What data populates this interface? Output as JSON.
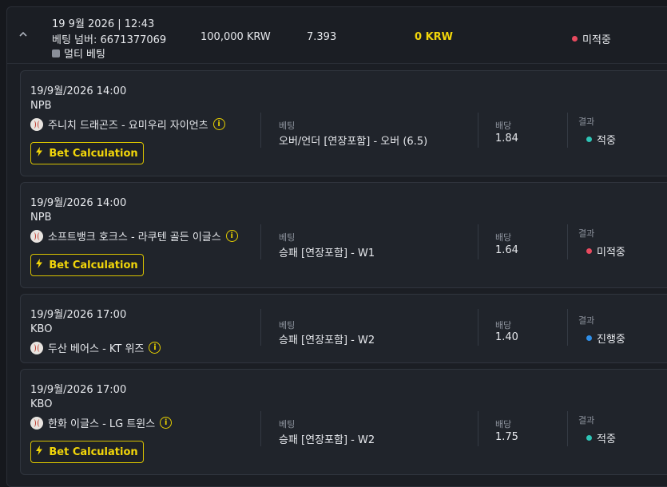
{
  "header": {
    "date": "19 9월 2026 | 12:43",
    "bet_number": "베팅 넘버: 6671377069",
    "bet_type": "멀티 베팅",
    "amount": "100,000 KRW",
    "odds": "7.393",
    "winnings": "0 KRW",
    "status": "미적중",
    "status_color": "#e84a5f"
  },
  "labels": {
    "bet": "베팅",
    "odds": "배당",
    "result": "결과",
    "calc_button": "Bet Calculation"
  },
  "cards": [
    {
      "date": "19/9월/2026 14:00",
      "league": "NPB",
      "match": "주니치 드래곤즈 - 요미우리 자이언츠",
      "bet": "오버/언더 [연장포함] - 오버 (6.5)",
      "odds": "1.84",
      "result": "적중",
      "result_color": "#2ec4b6",
      "has_calc": true
    },
    {
      "date": "19/9월/2026 14:00",
      "league": "NPB",
      "match": "소프트뱅크 호크스 - 라쿠텐 골든 이글스",
      "bet": "승패 [연장포함] - W1",
      "odds": "1.64",
      "result": "미적중",
      "result_color": "#e84a5f",
      "has_calc": true
    },
    {
      "date": "19/9월/2026 17:00",
      "league": "KBO",
      "match": "두산 베어스 - KT 위즈",
      "bet": "승패 [연장포함] - W2",
      "odds": "1.40",
      "result": "진행중",
      "result_color": "#2f8fe8",
      "has_calc": false
    },
    {
      "date": "19/9월/2026 17:00",
      "league": "KBO",
      "match": "한화 이글스 - LG 트윈스",
      "bet": "승패 [연장포함] - W2",
      "odds": "1.75",
      "result": "적중",
      "result_color": "#2ec4b6",
      "has_calc": true
    }
  ]
}
